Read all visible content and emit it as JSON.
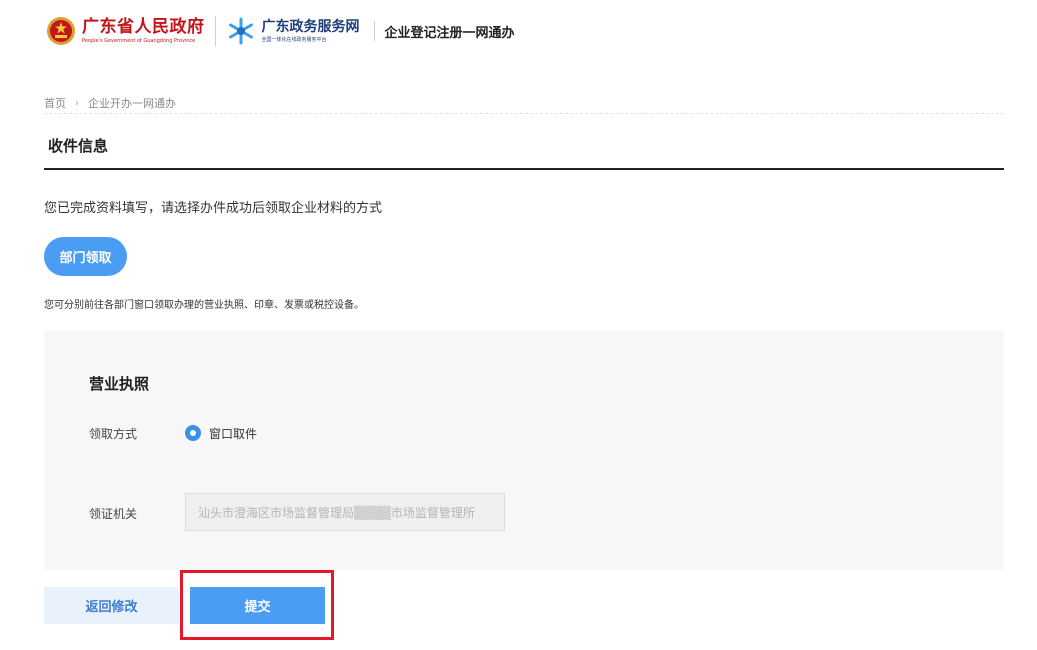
{
  "header": {
    "gov_name_cn": "广东省人民政府",
    "gov_name_en": "People's Government of Guangdong Province",
    "portal_name_cn": "广东政务服务网",
    "portal_sub": "全国一体化在线政务服务平台",
    "page_title": "企业登记注册一网通办",
    "gov_icon": "national-emblem-icon",
    "portal_icon": "snowflake-logo-icon"
  },
  "breadcrumb": {
    "items": [
      "首页",
      "企业开办一网通办"
    ],
    "separator": "›"
  },
  "section": {
    "title": "收件信息",
    "intro": "您已完成资料填写，请选择办件成功后领取企业材料的方式"
  },
  "pickup": {
    "dept_button": "部门领取",
    "hint": "您可分别前往各部门窗口领取办理的营业执照、印章、发票或税控设备。"
  },
  "license": {
    "title": "营业执照",
    "method_label": "领取方式",
    "method_option": "窗口取件",
    "method_selected": true,
    "office_label": "领证机关",
    "office_value": "汕头市澄海区市场监督管理局▒▒▒▒市场监督管理所"
  },
  "actions": {
    "back_label": "返回修改",
    "submit_label": "提交"
  },
  "colors": {
    "primary": "#4a9df2",
    "gov_red": "#c4151b",
    "highlight_red": "#e01a2b"
  }
}
